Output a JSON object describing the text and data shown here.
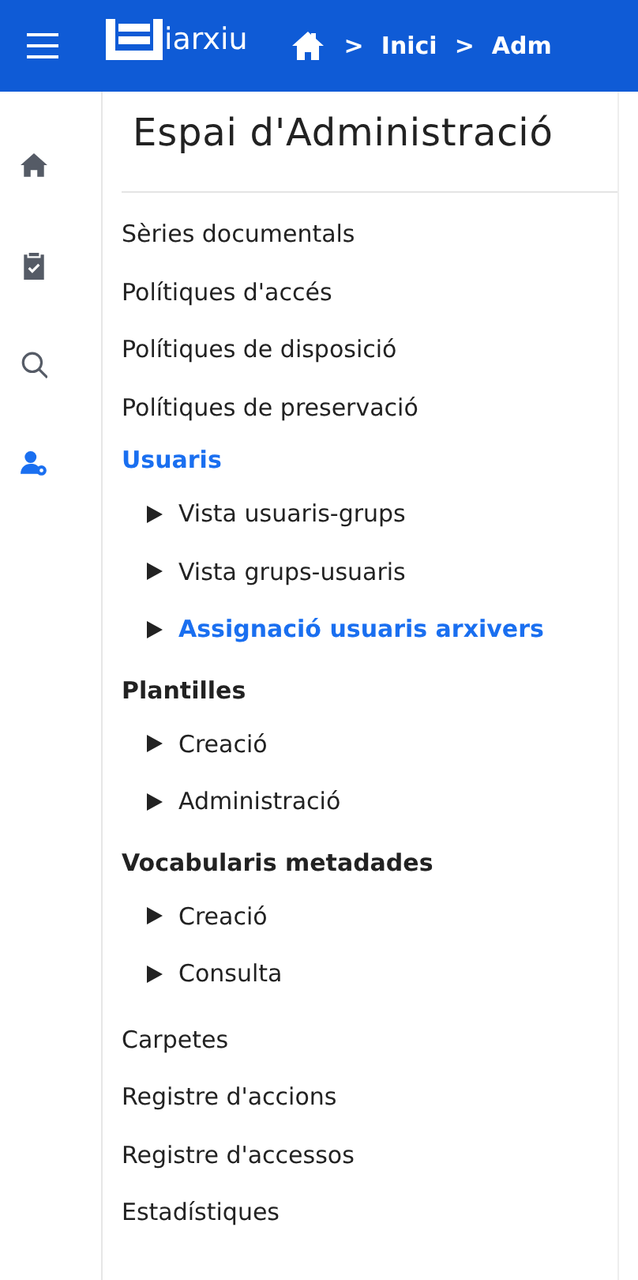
{
  "header": {
    "logo_text": "iarxiu",
    "breadcrumb": [
      {
        "kind": "home"
      },
      {
        "kind": "separator",
        "text": ">"
      },
      {
        "kind": "link",
        "text": "Inici"
      },
      {
        "kind": "separator",
        "text": ">"
      },
      {
        "kind": "link",
        "text": "Adm"
      }
    ]
  },
  "sidebar": {
    "items": [
      {
        "kind": "home",
        "selected": false
      },
      {
        "kind": "clipboard",
        "selected": false
      },
      {
        "kind": "search",
        "selected": false
      },
      {
        "kind": "users-admin",
        "selected": true
      }
    ]
  },
  "title": "Espai d'Administració",
  "menu": [
    {
      "kind": "link",
      "label": "Sèries documentals",
      "selected": false
    },
    {
      "kind": "link",
      "label": "Polítiques d'accés",
      "selected": false
    },
    {
      "kind": "link",
      "label": "Polítiques de disposició",
      "selected": false
    },
    {
      "kind": "link",
      "label": "Polítiques de preservació",
      "selected": false
    },
    {
      "kind": "group",
      "label": "Usuaris",
      "selected": true,
      "children": [
        {
          "label": "Vista usuaris-grups",
          "selected": false
        },
        {
          "label": "Vista grups-usuaris",
          "selected": false
        },
        {
          "label": "Assignació usuaris arxivers",
          "selected": true
        }
      ]
    },
    {
      "kind": "group",
      "label": "Plantilles",
      "selected": false,
      "children": [
        {
          "label": "Creació",
          "selected": false
        },
        {
          "label": "Administració",
          "selected": false
        }
      ]
    },
    {
      "kind": "group",
      "label": "Vocabularis metadades",
      "selected": false,
      "children": [
        {
          "label": "Creació",
          "selected": false
        },
        {
          "label": "Consulta",
          "selected": false
        }
      ]
    },
    {
      "kind": "link",
      "label": "Carpetes",
      "selected": false
    },
    {
      "kind": "link",
      "label": "Registre d'accions",
      "selected": false
    },
    {
      "kind": "link",
      "label": "Registre d'accessos",
      "selected": false
    },
    {
      "kind": "link",
      "label": "Estadístiques",
      "selected": false
    }
  ]
}
